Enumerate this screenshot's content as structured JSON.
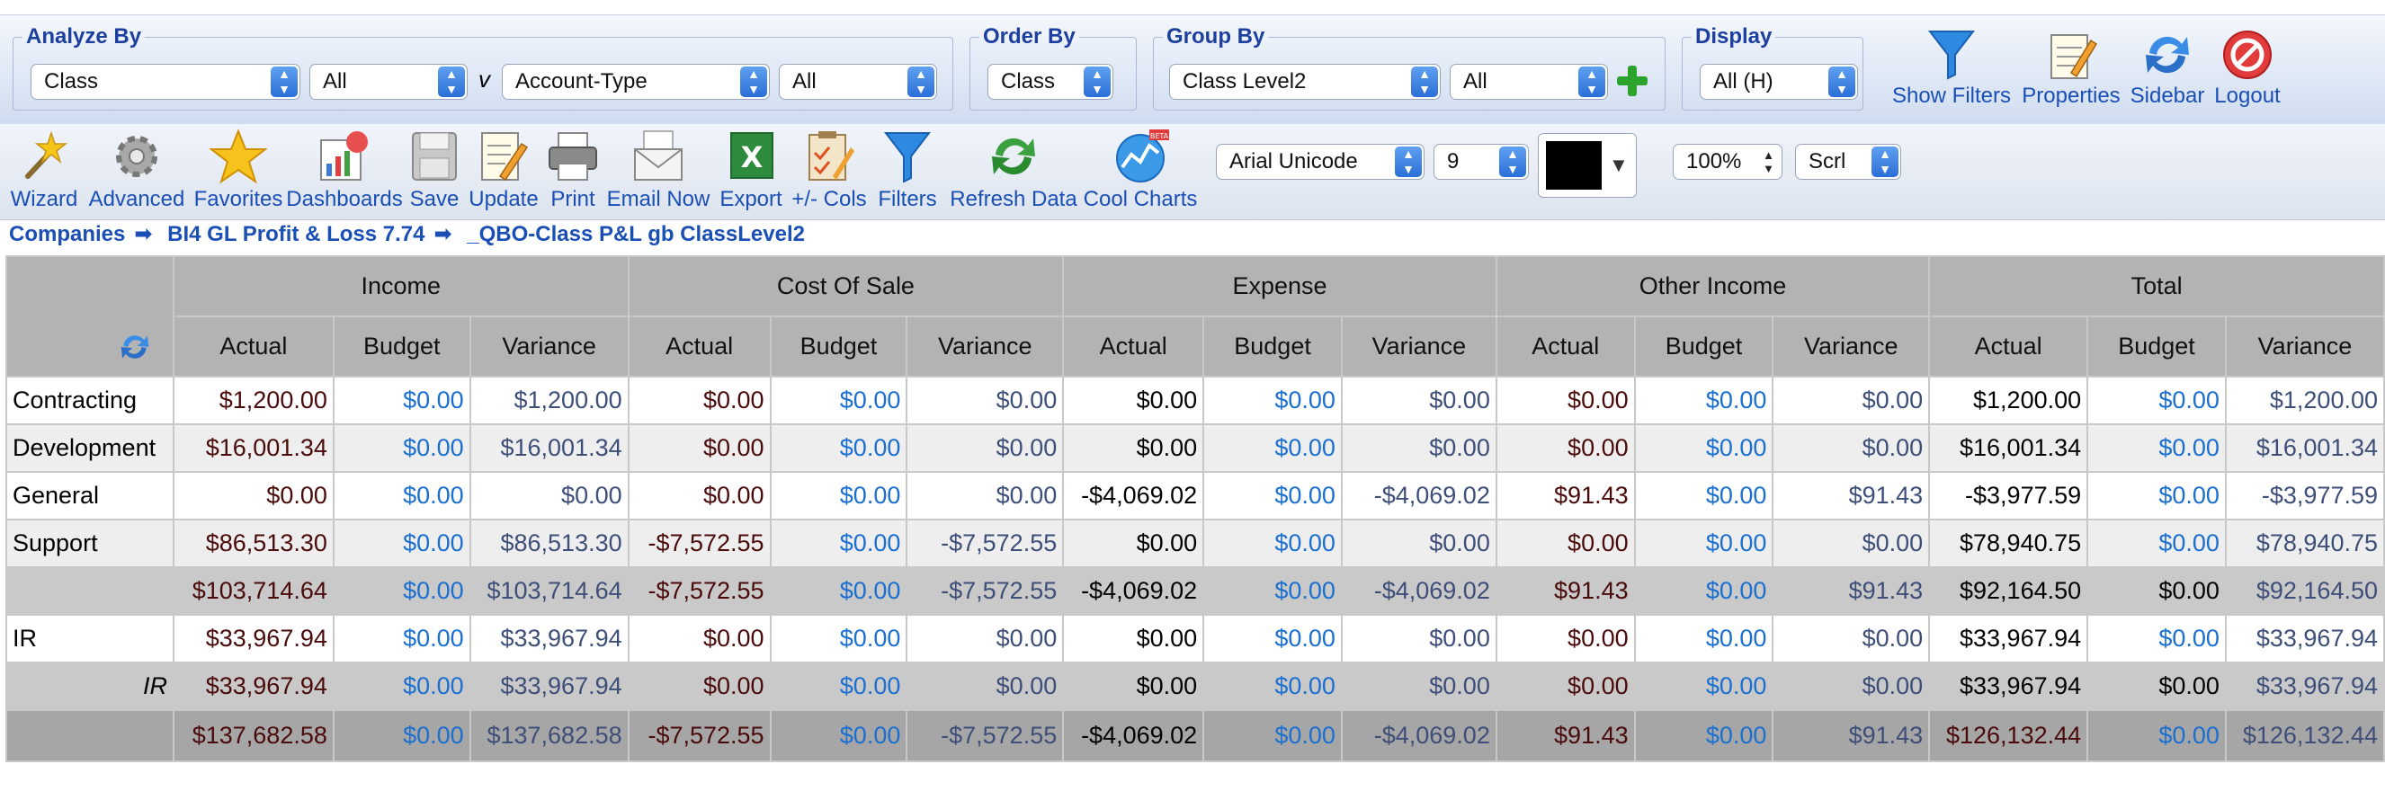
{
  "filters": {
    "analyze_by": {
      "legend": "Analyze By",
      "field": "Class",
      "field_value": "All",
      "v": "v",
      "type": "Account-Type",
      "type_value": "All"
    },
    "order_by": {
      "legend": "Order By",
      "value": "Class"
    },
    "group_by": {
      "legend": "Group By",
      "field": "Class Level2",
      "value": "All"
    },
    "display": {
      "legend": "Display",
      "value": "All (H)"
    }
  },
  "top_buttons": {
    "show_filters": "Show Filters",
    "properties": "Properties",
    "sidebar": "Sidebar",
    "logout": "Logout"
  },
  "toolbar": {
    "wizard": "Wizard",
    "advanced": "Advanced",
    "favorites": "Favorites",
    "dashboards": "Dashboards",
    "save": "Save",
    "update": "Update",
    "print": "Print",
    "email_now": "Email Now",
    "export": "Export",
    "cols": "+/- Cols",
    "filters": "Filters",
    "refresh_data": "Refresh Data",
    "cool_charts": "Cool Charts",
    "beta_badge": "BETA",
    "font": "Arial Unicode",
    "font_size": "9",
    "zoom": "100%",
    "scroll": "Scrl"
  },
  "breadcrumb": {
    "item1": "Companies",
    "item2": "BI4 GL Profit & Loss 7.74",
    "item3": "_QBO-Class P&L gb ClassLevel2",
    "separator": "➡"
  },
  "colors": {
    "link_blue": "#1a4fb5",
    "header_gray": "#b3b3b3",
    "budget_blue": "#1a6fd0",
    "swatch": "#000000"
  },
  "table": {
    "groups": [
      "Income",
      "Cost Of Sale",
      "Expense",
      "Other Income",
      "Total"
    ],
    "subheaders": [
      "Actual",
      "Budget",
      "Variance"
    ],
    "rows": [
      {
        "label": "Contracting",
        "cells": [
          "$1,200.00",
          "$0.00",
          "$1,200.00",
          "$0.00",
          "$0.00",
          "$0.00",
          "$0.00",
          "$0.00",
          "$0.00",
          "$0.00",
          "$0.00",
          "$0.00",
          "$1,200.00",
          "$0.00",
          "$1,200.00"
        ]
      },
      {
        "label": "Development",
        "cells": [
          "$16,001.34",
          "$0.00",
          "$16,001.34",
          "$0.00",
          "$0.00",
          "$0.00",
          "$0.00",
          "$0.00",
          "$0.00",
          "$0.00",
          "$0.00",
          "$0.00",
          "$16,001.34",
          "$0.00",
          "$16,001.34"
        ]
      },
      {
        "label": "General",
        "cells": [
          "$0.00",
          "$0.00",
          "$0.00",
          "$0.00",
          "$0.00",
          "$0.00",
          "-$4,069.02",
          "$0.00",
          "-$4,069.02",
          "$91.43",
          "$0.00",
          "$91.43",
          "-$3,977.59",
          "$0.00",
          "-$3,977.59"
        ]
      },
      {
        "label": "Support",
        "cells": [
          "$86,513.30",
          "$0.00",
          "$86,513.30",
          "-$7,572.55",
          "$0.00",
          "-$7,572.55",
          "$0.00",
          "$0.00",
          "$0.00",
          "$0.00",
          "$0.00",
          "$0.00",
          "$78,940.75",
          "$0.00",
          "$78,940.75"
        ]
      },
      {
        "label": "",
        "cells": [
          "$103,714.64",
          "$0.00",
          "$103,714.64",
          "-$7,572.55",
          "$0.00",
          "-$7,572.55",
          "-$4,069.02",
          "$0.00",
          "-$4,069.02",
          "$91.43",
          "$0.00",
          "$91.43",
          "$92,164.50",
          "$0.00",
          "$92,164.50"
        ]
      },
      {
        "label": "IR",
        "cells": [
          "$33,967.94",
          "$0.00",
          "$33,967.94",
          "$0.00",
          "$0.00",
          "$0.00",
          "$0.00",
          "$0.00",
          "$0.00",
          "$0.00",
          "$0.00",
          "$0.00",
          "$33,967.94",
          "$0.00",
          "$33,967.94"
        ]
      },
      {
        "label": "IR",
        "cells": [
          "$33,967.94",
          "$0.00",
          "$33,967.94",
          "$0.00",
          "$0.00",
          "$0.00",
          "$0.00",
          "$0.00",
          "$0.00",
          "$0.00",
          "$0.00",
          "$0.00",
          "$33,967.94",
          "$0.00",
          "$33,967.94"
        ]
      },
      {
        "label": "",
        "cells": [
          "$137,682.58",
          "$0.00",
          "$137,682.58",
          "-$7,572.55",
          "$0.00",
          "-$7,572.55",
          "-$4,069.02",
          "$0.00",
          "-$4,069.02",
          "$91.43",
          "$0.00",
          "$91.43",
          "$126,132.44",
          "$0.00",
          "$126,132.44"
        ]
      }
    ]
  }
}
